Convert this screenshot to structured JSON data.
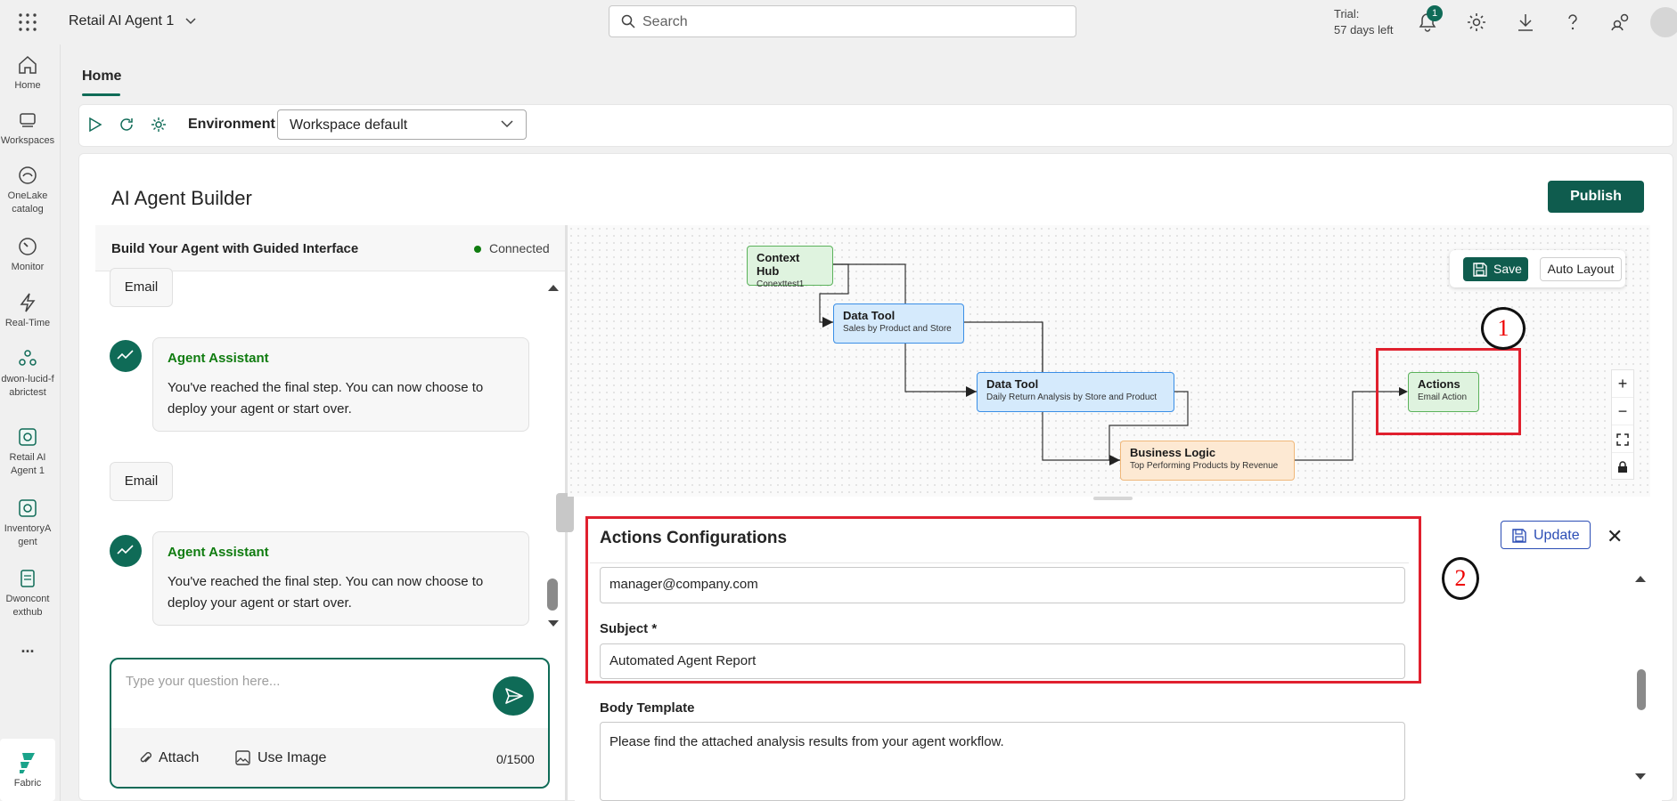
{
  "topbar": {
    "app_title": "Retail AI Agent 1",
    "search_placeholder": "Search",
    "trial_label": "Trial:",
    "trial_days": "57 days left",
    "notification_count": "1"
  },
  "rail": {
    "items": [
      {
        "label": "Home"
      },
      {
        "label": "Workspaces"
      },
      {
        "label": "OneLake catalog"
      },
      {
        "label": "Monitor"
      },
      {
        "label": "Real-Time"
      },
      {
        "label": "dwon-lucid-fabrictest"
      },
      {
        "label": "Retail AI Agent 1"
      },
      {
        "label": "InventoryAgent"
      },
      {
        "label": "Dwoncontexthub"
      }
    ],
    "more": "...",
    "fabric_label": "Fabric"
  },
  "tabs": {
    "home": "Home"
  },
  "toolbar": {
    "environment_label": "Environment",
    "environment_value": "Workspace default"
  },
  "builder": {
    "title": "AI Agent Builder",
    "publish_label": "Publish"
  },
  "chat": {
    "header_title": "Build Your Agent with Guided Interface",
    "status": "Connected",
    "chip1": "Email",
    "agent1_name": "Agent Assistant",
    "agent1_msg": "You've reached the final step. You can now choose to deploy your agent or start over.",
    "chip2": "Email",
    "agent2_name": "Agent Assistant",
    "agent2_msg": "You've reached the final step. You can now choose to deploy your agent or start over.",
    "input_placeholder": "Type your question here...",
    "attach_label": "Attach",
    "use_image_label": "Use Image",
    "counter": "0/1500"
  },
  "canvas": {
    "save_label": "Save",
    "auto_layout_label": "Auto Layout",
    "nodes": [
      {
        "title": "Context Hub",
        "subtitle": "Conexttest1"
      },
      {
        "title": "Data Tool",
        "subtitle": "Sales by Product and Store"
      },
      {
        "title": "Data Tool",
        "subtitle": "Daily Return Analysis by Store and Product"
      },
      {
        "title": "Business Logic",
        "subtitle": "Top Performing Products by Revenue"
      },
      {
        "title": "Actions",
        "subtitle": "Email Action"
      }
    ],
    "zoom": [
      "+",
      "−"
    ],
    "annotation_1": "1",
    "annotation_2": "2"
  },
  "config": {
    "title": "Actions Configurations",
    "update_label": "Update",
    "close": "✕",
    "to_value": "manager@company.com",
    "subject_label": "Subject *",
    "subject_value": "Automated Agent Report",
    "body_label": "Body Template",
    "body_value": "Please find the attached analysis results from your agent workflow."
  },
  "colors": {
    "accent": "#0f6b57",
    "annotation_red": "#e0202e",
    "node_green": "#dff3df",
    "node_blue": "#d5eafc",
    "node_orange": "#fde9d3"
  }
}
